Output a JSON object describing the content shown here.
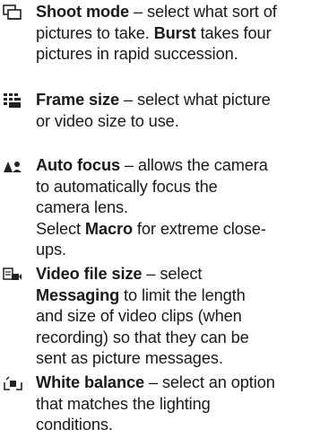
{
  "items": [
    {
      "icon": "shoot-mode-icon",
      "title": "Shoot mode",
      "lines": [
        [
          " – select what sort of"
        ],
        [
          "pictures to take. ",
          {
            "b": "Burst"
          },
          " takes four"
        ],
        [
          "pictures in rapid succession."
        ]
      ]
    },
    {
      "icon": "frame-size-icon",
      "title": "Frame size",
      "lines": [
        [
          " – select what picture"
        ],
        [
          "or video size to use."
        ]
      ]
    },
    {
      "icon": "auto-focus-icon",
      "title": "Auto focus",
      "lines": [
        [
          " – allows the camera"
        ],
        [
          "to automatically focus the"
        ],
        [
          "camera lens."
        ],
        [
          "Select ",
          {
            "b": "Macro"
          },
          " for extreme close-"
        ],
        [
          "ups."
        ]
      ]
    },
    {
      "icon": "video-file-size-icon",
      "title": "Video file size",
      "lines": [
        [
          " – select"
        ],
        [
          {
            "b": "Messaging"
          },
          " to limit the length"
        ],
        [
          "and size of video clips (when"
        ],
        [
          "recording) so that they can be"
        ],
        [
          "sent as picture messages."
        ]
      ]
    },
    {
      "icon": "white-balance-icon",
      "title": "White balance",
      "lines": [
        [
          " – select an option"
        ],
        [
          "that matches the lighting"
        ],
        [
          "conditions."
        ]
      ]
    }
  ]
}
